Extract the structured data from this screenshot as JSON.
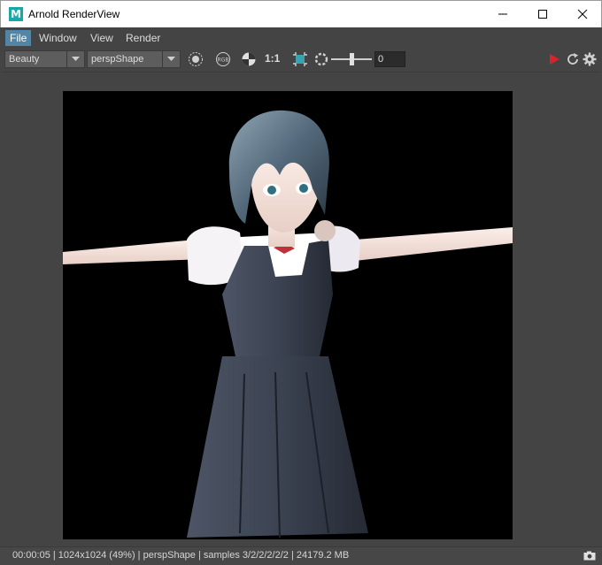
{
  "window": {
    "title": "Arnold RenderView",
    "app_icon_letter": "M"
  },
  "menu": {
    "items": [
      "File",
      "Window",
      "View",
      "Render"
    ]
  },
  "toolbar": {
    "aov_value": "Beauty",
    "camera_value": "perspShape",
    "rgb_label": "RGB",
    "zoom_label": "1:1",
    "exposure_value": "0",
    "exposure_level": 0.5
  },
  "status": {
    "text": "00:00:05 | 1024x1024 (49%) | perspShape  | samples 3/2/2/2/2/2 | 24179.2 MB"
  },
  "colors": {
    "accent": "#5285a6",
    "render_button": "#d9232a",
    "background": "#444444"
  },
  "icons": [
    "minimize-icon",
    "maximize-icon",
    "close-icon",
    "render-region-icon",
    "rgb-channel-icon",
    "display-mode-icon",
    "crop-region-icon",
    "exposure-icon",
    "render-start-icon",
    "refresh-icon",
    "settings-icon",
    "snapshot-icon"
  ]
}
